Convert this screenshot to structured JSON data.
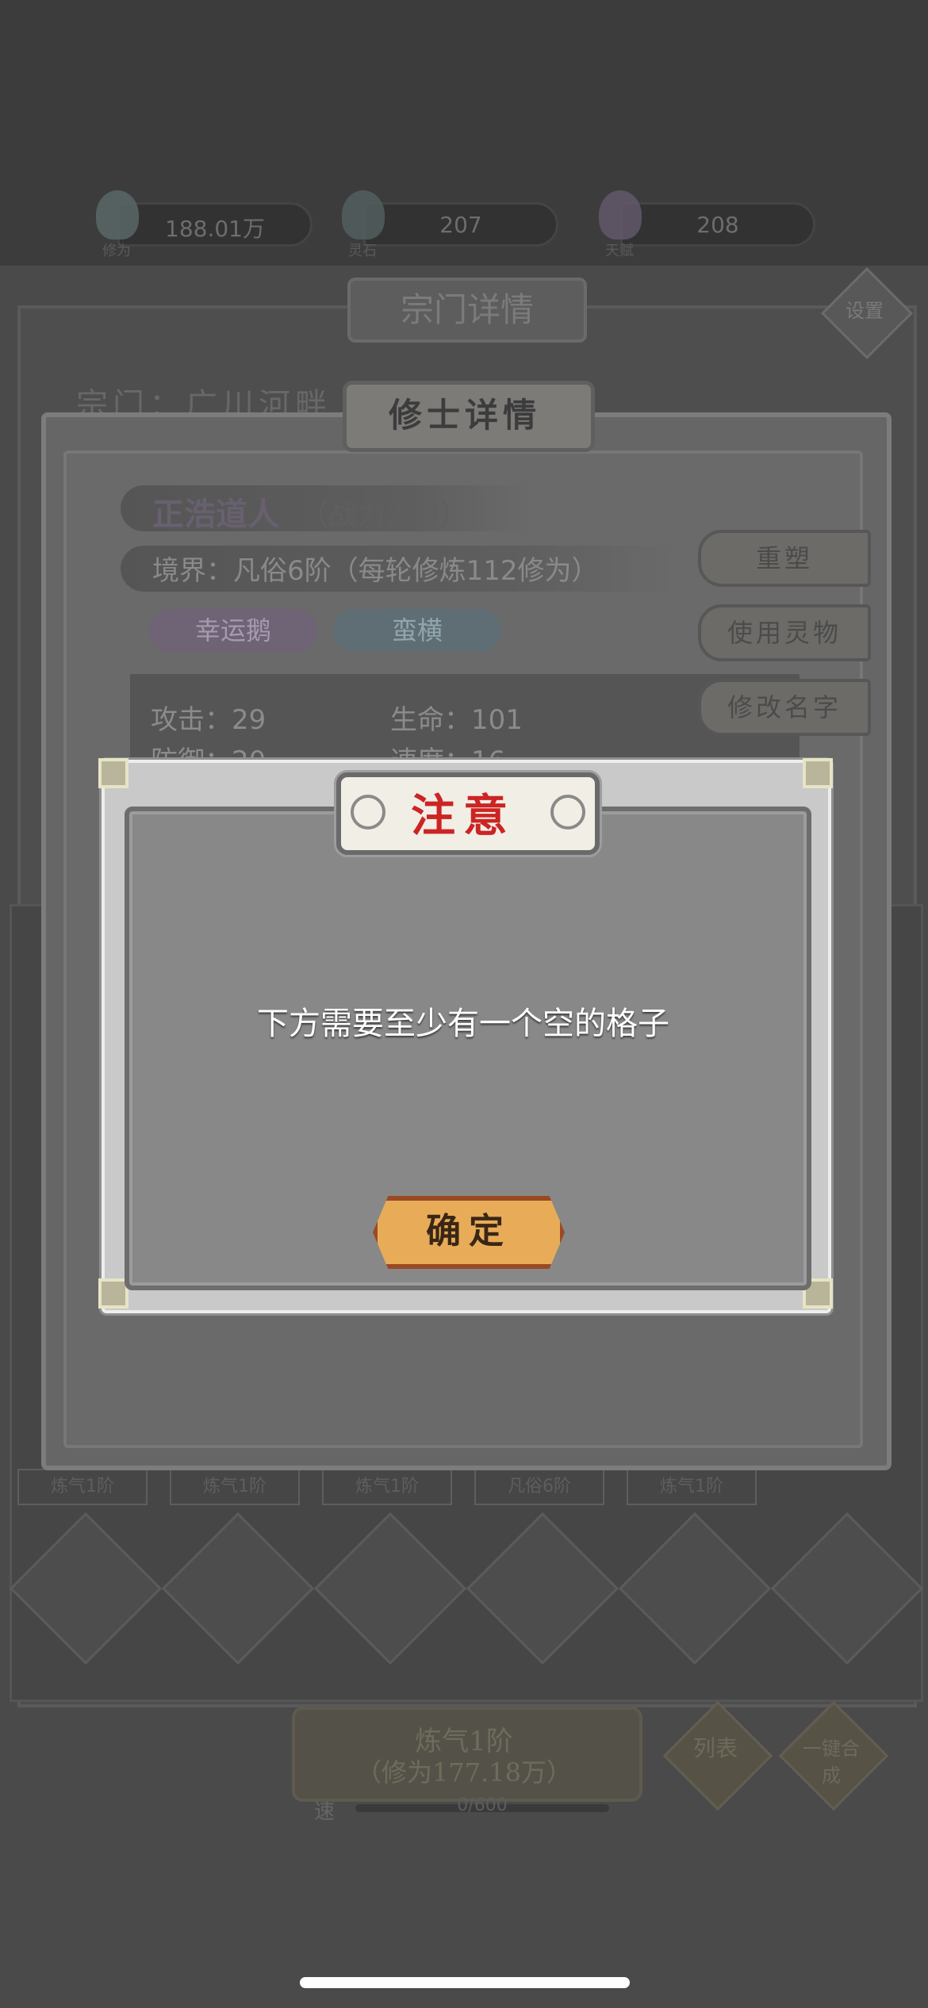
{
  "resources": [
    {
      "value": "188.01万",
      "caption": "修为",
      "icon": "spirit-crystal-icon"
    },
    {
      "value": "207",
      "caption": "灵石",
      "icon": "spirit-stone-icon"
    },
    {
      "value": "208",
      "caption": "天赋",
      "icon": "talent-gem-icon"
    }
  ],
  "sect": {
    "title": "宗门详情",
    "settings_label": "设置",
    "name": "宗门：广川河畔"
  },
  "slot_labels": [
    "炼气1阶",
    "炼气1阶",
    "炼气1阶",
    "凡俗6阶",
    "炼气1阶"
  ],
  "bottom": {
    "main_line1": "炼气1阶",
    "main_line2": "（修为177.18万）",
    "list_label": "列表",
    "merge_label": "一键合成",
    "progress_label": "速",
    "progress_value": "0/600"
  },
  "detail": {
    "title": "修士详情",
    "name": "正浩道人",
    "power": "（战力383）",
    "realm": "境界：凡俗6阶（每轮修炼112修为）",
    "tags": [
      "幸运鹅",
      "蛮横"
    ],
    "stats": {
      "attack": "攻击：29",
      "hp": "生命：101",
      "defense": "防御：20",
      "speed": "速度：16"
    },
    "side_buttons": [
      "重塑",
      "使用灵物",
      "修改名字"
    ]
  },
  "dialog": {
    "title": "注意",
    "message": "下方需要至少有一个空的格子",
    "confirm_label": "确定"
  },
  "colors": {
    "dialog_title": "#cc2424",
    "confirm_button": "#e8ac59",
    "tag_lucky_goose": "#6f6476",
    "tag_brute": "#5f6e74"
  }
}
